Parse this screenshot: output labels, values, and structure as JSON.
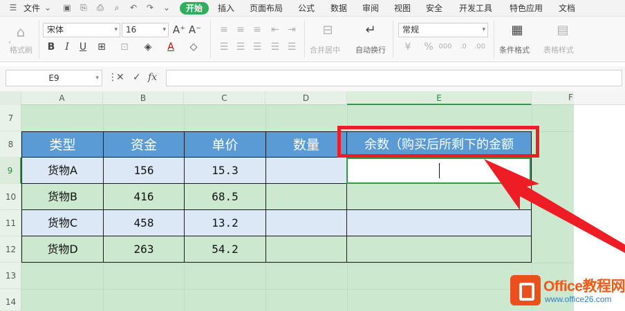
{
  "menu": {
    "file": "文件",
    "tabs": [
      "开始",
      "插入",
      "页面布局",
      "公式",
      "数据",
      "审阅",
      "视图",
      "安全",
      "开发工具",
      "特色应用",
      "文档"
    ]
  },
  "ribbon": {
    "format_painter": "格式刷",
    "font_name": "宋体",
    "font_size": "16",
    "merge_center": "合并居中",
    "wrap_text": "自动换行",
    "number_format": "常规",
    "conditional_format": "条件格式",
    "table_style": "表格样式"
  },
  "formula_bar": {
    "name_box": "E9",
    "fx": "fx",
    "value": ""
  },
  "grid": {
    "columns": [
      "A",
      "B",
      "C",
      "D",
      "E",
      "F"
    ],
    "rows": [
      "7",
      "8",
      "9",
      "10",
      "11",
      "12",
      "13",
      "14"
    ],
    "active_column": "E",
    "active_row": "9"
  },
  "table": {
    "headers": [
      "类型",
      "资金",
      "单价",
      "数量",
      "余数（购买后所剩下的金额"
    ],
    "rows": [
      [
        "货物A",
        "156",
        "15.3",
        "",
        ""
      ],
      [
        "货物B",
        "416",
        "68.5",
        "",
        ""
      ],
      [
        "货物C",
        "458",
        "13.2",
        "",
        ""
      ],
      [
        "货物D",
        "263",
        "54.2",
        "",
        ""
      ]
    ]
  },
  "logo": {
    "title": "Office教程网",
    "url": "www.office26.com"
  },
  "colors": {
    "accent_green": "#2fae5e",
    "header_blue": "#5b9bd5",
    "row_blue": "#dce8f5",
    "sheet_green": "#cce8cf",
    "callout_red": "#ee1c25",
    "logo_orange": "#ea4f1c"
  }
}
